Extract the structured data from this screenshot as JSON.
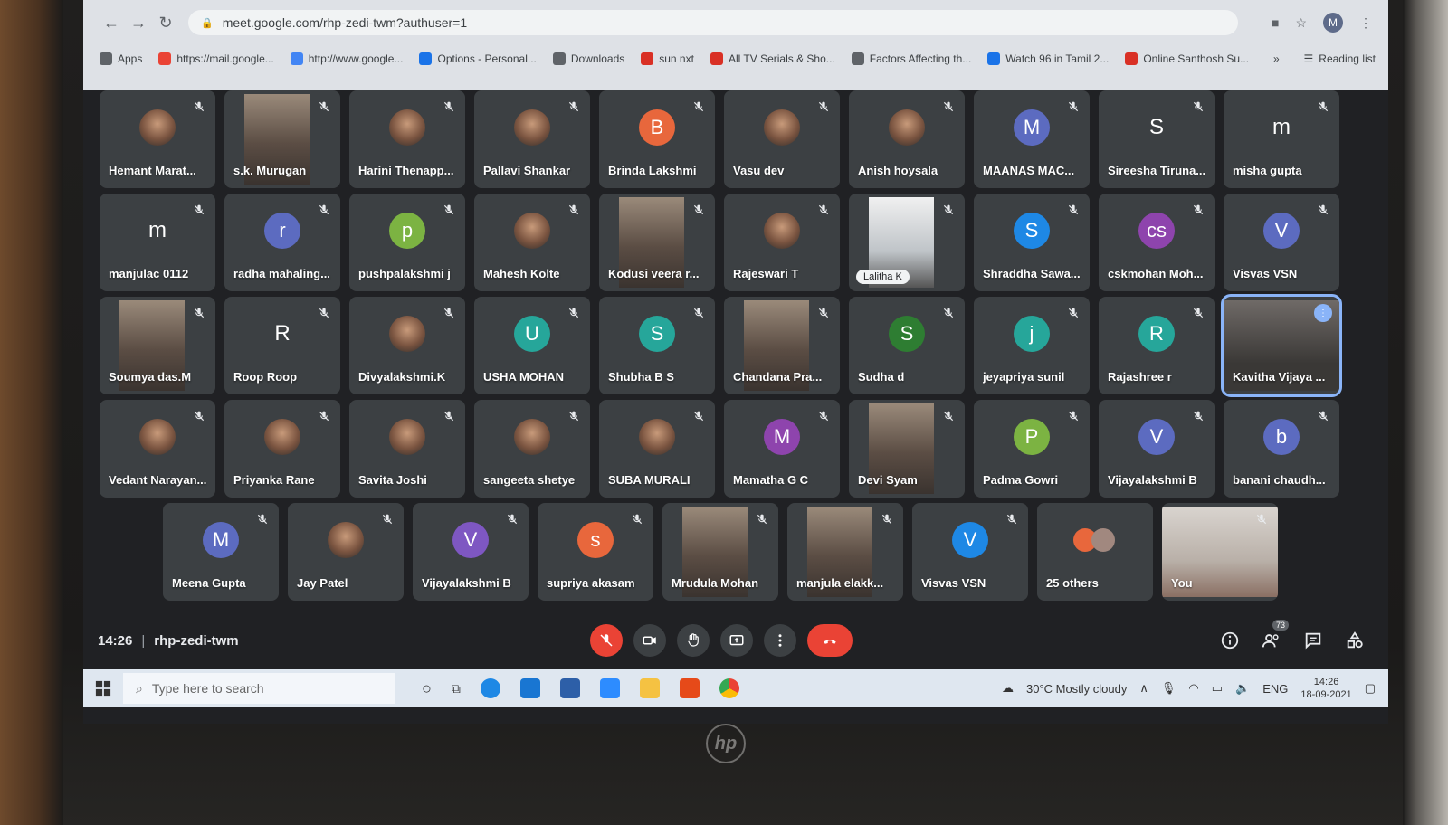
{
  "browser": {
    "url": "meet.google.com/rhp-zedi-twm?authuser=1",
    "profile_initial": "M",
    "bookmarks": [
      {
        "label": "Apps",
        "icon": "apps-grid-icon",
        "color": "#5f6368"
      },
      {
        "label": "https://mail.google...",
        "icon": "gmail-icon",
        "color": "#ea4335"
      },
      {
        "label": "http://www.google...",
        "icon": "google-icon",
        "color": "#4285f4"
      },
      {
        "label": "Options - Personal...",
        "icon": "gear-icon",
        "color": "#1a73e8"
      },
      {
        "label": "Downloads",
        "icon": "download-icon",
        "color": "#5f6368"
      },
      {
        "label": "sun nxt",
        "icon": "site-icon",
        "color": "#d93025"
      },
      {
        "label": "All TV Serials & Sho...",
        "icon": "site-icon",
        "color": "#d93025"
      },
      {
        "label": "Factors Affecting th...",
        "icon": "site-icon",
        "color": "#5f6368"
      },
      {
        "label": "Watch 96 in Tamil 2...",
        "icon": "play-icon",
        "color": "#1a73e8"
      },
      {
        "label": "Online Santhosh Su...",
        "icon": "site-icon",
        "color": "#d93025"
      }
    ],
    "more_bookmarks": "»",
    "reading_list": "Reading list"
  },
  "participants": [
    {
      "name": "Hemant Marat...",
      "type": "photo"
    },
    {
      "name": "s.k. Murugan",
      "type": "video"
    },
    {
      "name": "Harini Thenapp...",
      "type": "photo"
    },
    {
      "name": "Pallavi Shankar",
      "type": "photo"
    },
    {
      "name": "Brinda Lakshmi",
      "type": "letter",
      "initial": "B",
      "color": "#e8673c"
    },
    {
      "name": "Vasu dev",
      "type": "photo"
    },
    {
      "name": "Anish hoysala",
      "type": "photo"
    },
    {
      "name": "MAANAS MAC...",
      "type": "letter",
      "initial": "M",
      "color": "#5c6bc0"
    },
    {
      "name": "Sireesha Tiruna...",
      "type": "letter",
      "initial": "S",
      "color": "transparent"
    },
    {
      "name": "misha gupta",
      "type": "letter",
      "initial": "m",
      "color": "transparent"
    },
    {
      "name": "manjulac 0112",
      "type": "letter",
      "initial": "m",
      "color": "transparent"
    },
    {
      "name": "radha mahaling...",
      "type": "letter",
      "initial": "r",
      "color": "#5c6bc0"
    },
    {
      "name": "pushpalakshmi j",
      "type": "letter",
      "initial": "p",
      "color": "#7cb342"
    },
    {
      "name": "Mahesh Kolte",
      "type": "photo"
    },
    {
      "name": "Kodusi veera r...",
      "type": "video"
    },
    {
      "name": "Rajeswari T",
      "type": "photo"
    },
    {
      "name": "Lalitha K",
      "type": "video-chip"
    },
    {
      "name": "Shraddha Sawa...",
      "type": "letter",
      "initial": "S",
      "color": "#1e88e5"
    },
    {
      "name": "cskmohan Moh...",
      "type": "letter",
      "initial": "cs",
      "color": "#8e44ad"
    },
    {
      "name": "Visvas VSN",
      "type": "letter",
      "initial": "V",
      "color": "#5c6bc0"
    },
    {
      "name": "Soumya das.M",
      "type": "video"
    },
    {
      "name": "Roop Roop",
      "type": "letter",
      "initial": "R",
      "color": "transparent"
    },
    {
      "name": "Divyalakshmi.K",
      "type": "photo"
    },
    {
      "name": "USHA MOHAN",
      "type": "letter",
      "initial": "U",
      "color": "#26a69a"
    },
    {
      "name": "Shubha B S",
      "type": "letter",
      "initial": "S",
      "color": "#26a69a"
    },
    {
      "name": "Chandana Pra...",
      "type": "video"
    },
    {
      "name": "Sudha d",
      "type": "letter",
      "initial": "S",
      "color": "#2e7d32"
    },
    {
      "name": "jeyapriya sunil",
      "type": "letter",
      "initial": "j",
      "color": "#26a69a"
    },
    {
      "name": "Rajashree r",
      "type": "letter",
      "initial": "R",
      "color": "#26a69a"
    },
    {
      "name": "Kavitha Vijaya ...",
      "type": "video-active"
    },
    {
      "name": "Vedant Narayan...",
      "type": "photo"
    },
    {
      "name": "Priyanka Rane",
      "type": "photo"
    },
    {
      "name": "Savita Joshi",
      "type": "photo"
    },
    {
      "name": "sangeeta shetye",
      "type": "photo"
    },
    {
      "name": "SUBA MURALI",
      "type": "photo"
    },
    {
      "name": "Mamatha G C",
      "type": "letter",
      "initial": "M",
      "color": "#8e44ad"
    },
    {
      "name": "Devi Syam",
      "type": "video"
    },
    {
      "name": "Padma Gowri",
      "type": "letter",
      "initial": "P",
      "color": "#7cb342"
    },
    {
      "name": "Vijayalakshmi B",
      "type": "letter",
      "initial": "V",
      "color": "#5c6bc0"
    },
    {
      "name": "banani chaudh...",
      "type": "letter",
      "initial": "b",
      "color": "#5c6bc0"
    },
    {
      "name": "Meena Gupta",
      "type": "letter",
      "initial": "M",
      "color": "#5c6bc0"
    },
    {
      "name": "Jay Patel",
      "type": "photo"
    },
    {
      "name": "Vijayalakshmi B",
      "type": "letter",
      "initial": "V",
      "color": "#7e57c2"
    },
    {
      "name": "supriya akasam",
      "type": "letter",
      "initial": "s",
      "color": "#e8673c"
    },
    {
      "name": "Mrudula Mohan",
      "type": "video"
    },
    {
      "name": "manjula elakk...",
      "type": "video"
    },
    {
      "name": "Visvas VSN",
      "type": "letter",
      "initial": "V",
      "color": "#1e88e5"
    },
    {
      "name": "25 others",
      "type": "others"
    },
    {
      "name": "You",
      "type": "video-self"
    }
  ],
  "meeting": {
    "time": "14:26",
    "separator": "|",
    "code": "rhp-zedi-twm",
    "people_count": "73"
  },
  "taskbar": {
    "search_placeholder": "Type here to search",
    "weather": "30°C  Mostly cloudy",
    "language": "ENG",
    "time": "14:26",
    "date": "18-09-2021"
  },
  "brand": "hp"
}
